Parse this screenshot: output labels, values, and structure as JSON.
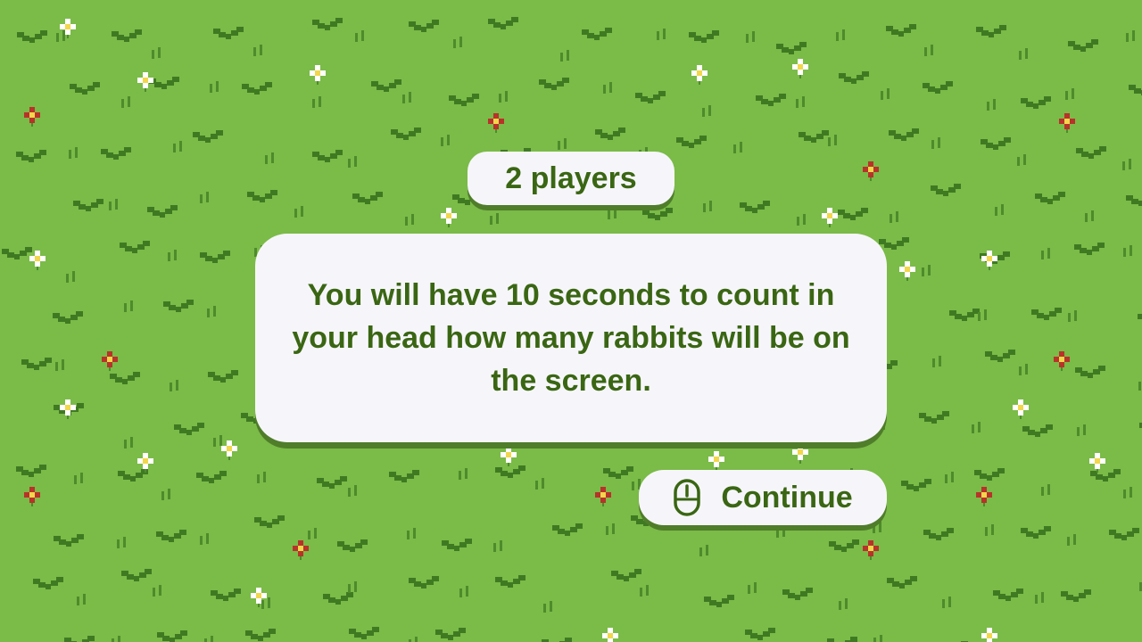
{
  "players_label": "2 players",
  "message": "You will have 10 seconds to count in your head how many rabbits will be on the screen.",
  "continue_label": "Continue",
  "icons": {
    "continue_icon": "mouse-icon"
  },
  "colors": {
    "grass": "#7bbb48",
    "text": "#3a6613",
    "panel": "#f6f6fa",
    "panel_shadow": "#4f7d2a",
    "leaf": "#3f7a22",
    "leaf_light": "#5e9a33",
    "flower_white": "#ffffff",
    "flower_red": "#b8322a",
    "flower_center": "#f2d64b"
  }
}
